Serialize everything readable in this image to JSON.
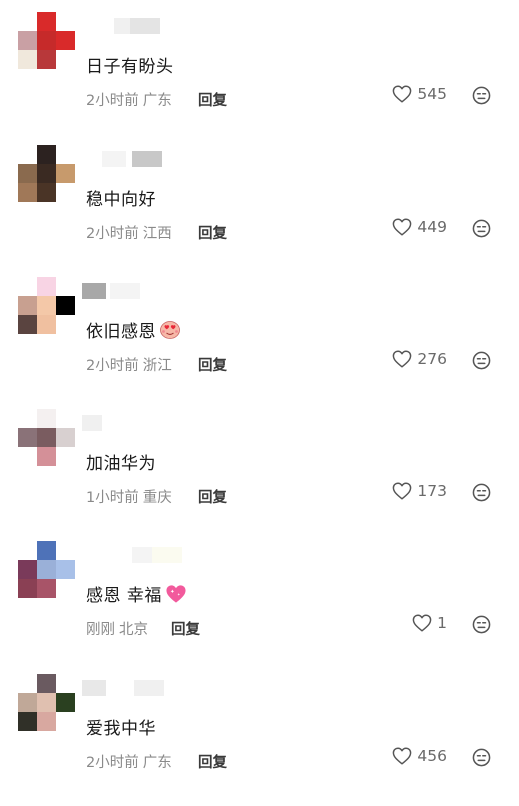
{
  "colors": {
    "text": "#1a1a1a",
    "meta": "#8a8a8a",
    "reply": "#3a3a3a"
  },
  "comments": [
    {
      "text": "日子有盼头",
      "time": "2小时前",
      "location": "广东",
      "reply": "回复",
      "likes": "545",
      "avatar_colors": [
        "#ffffff",
        "#d92a2a",
        "#ffffff",
        "#c9a0a4",
        "#c62a2a",
        "#d92a2a",
        "#f0e8dc",
        "#b8383a",
        "#ffffff"
      ],
      "name_blur": [
        "#f0f0f0",
        "#e4e4e4"
      ]
    },
    {
      "text": "稳中向好",
      "time": "2小时前",
      "location": "江西",
      "reply": "回复",
      "likes": "449",
      "avatar_colors": [
        "#ffffff",
        "#2c2220",
        "#ffffff",
        "#8a6a4e",
        "#3a2a22",
        "#c79a6c",
        "#a07858",
        "#4a3426",
        "#ffffff"
      ],
      "name_blur": [
        "#f4f4f4",
        "#c8c8c8"
      ]
    },
    {
      "text": "依旧感恩",
      "time": "2小时前",
      "location": "浙江",
      "reply": "回复",
      "likes": "276",
      "emoji": "face-with-heart-eyes",
      "avatar_colors": [
        "#ffffff",
        "#f8d4e4",
        "#ffffff",
        "#c8a090",
        "#f4c8a8",
        "#000000",
        "#5a4440",
        "#f0c0a0",
        "#ffffff"
      ],
      "name_blur": [
        "#a8a8a8",
        "#f4f4f4"
      ]
    },
    {
      "text": "加油华为",
      "time": "1小时前",
      "location": "重庆",
      "reply": "回复",
      "likes": "173",
      "avatar_colors": [
        "#ffffff",
        "#f4f0f0",
        "#ffffff",
        "#8a7278",
        "#7a5c60",
        "#d8d0d0",
        "#ffffff",
        "#d49098",
        "#ffffff"
      ],
      "name_blur": [
        "#f0f0f0",
        "#ffffff"
      ]
    },
    {
      "text": "感恩 幸福",
      "time": "刚刚",
      "location": "北京",
      "reply": "回复",
      "likes": "1",
      "emoji": "sparkling-heart",
      "avatar_colors": [
        "#ffffff",
        "#4e72b8",
        "#ffffff",
        "#7a3a5a",
        "#9ab0d8",
        "#a8c0e8",
        "#8a4054",
        "#a85468",
        "#ffffff"
      ],
      "name_blur": [
        "#f4f4f4",
        "#fbfbf0"
      ]
    },
    {
      "text": "爱我中华",
      "time": "2小时前",
      "location": "广东",
      "reply": "回复",
      "likes": "456",
      "avatar_colors": [
        "#ffffff",
        "#6a5a60",
        "#ffffff",
        "#c0a898",
        "#e0c0b0",
        "#2a4020",
        "#303028",
        "#d8a8a0",
        "#ffffff"
      ],
      "name_blur": [
        "#e8e8e8",
        "#f0f0f0"
      ]
    }
  ]
}
